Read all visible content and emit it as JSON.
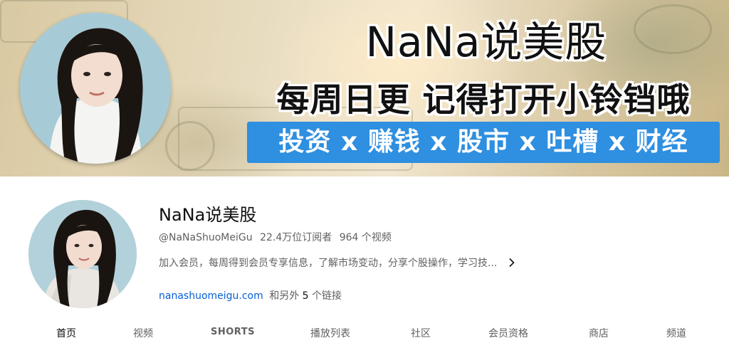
{
  "banner": {
    "title": "NaNa说美股",
    "subtitle": "每周日更 记得打开小铃铛哦",
    "tags": "投资 x 赚钱 x 股市 x 吐槽 x 财经"
  },
  "channel": {
    "name": "NaNa说美股",
    "handle": "@NaNaShuoMeiGu",
    "subscribers": "22.4万位订阅者",
    "videos": "964 个视频",
    "description": "加入会员，每周得到会员专享信息，了解市场变动，分享个股操作，学习技...",
    "link": "nanashuomeigu.com",
    "links_prefix": "和另外",
    "links_count": "5",
    "links_suffix": "个链接"
  },
  "tabs": [
    {
      "label": "首页"
    },
    {
      "label": "视频"
    },
    {
      "label": "SHORTS"
    },
    {
      "label": "播放列表"
    },
    {
      "label": "社区"
    },
    {
      "label": "会员资格"
    },
    {
      "label": "商店"
    },
    {
      "label": "频道"
    }
  ],
  "icons": {
    "description_expand": "chevron-right-icon"
  },
  "colors": {
    "banner_tag_bg": "#2f8fe0",
    "link": "#065fd4",
    "secondary_text": "#606060",
    "primary_text": "#0f0f0f"
  }
}
